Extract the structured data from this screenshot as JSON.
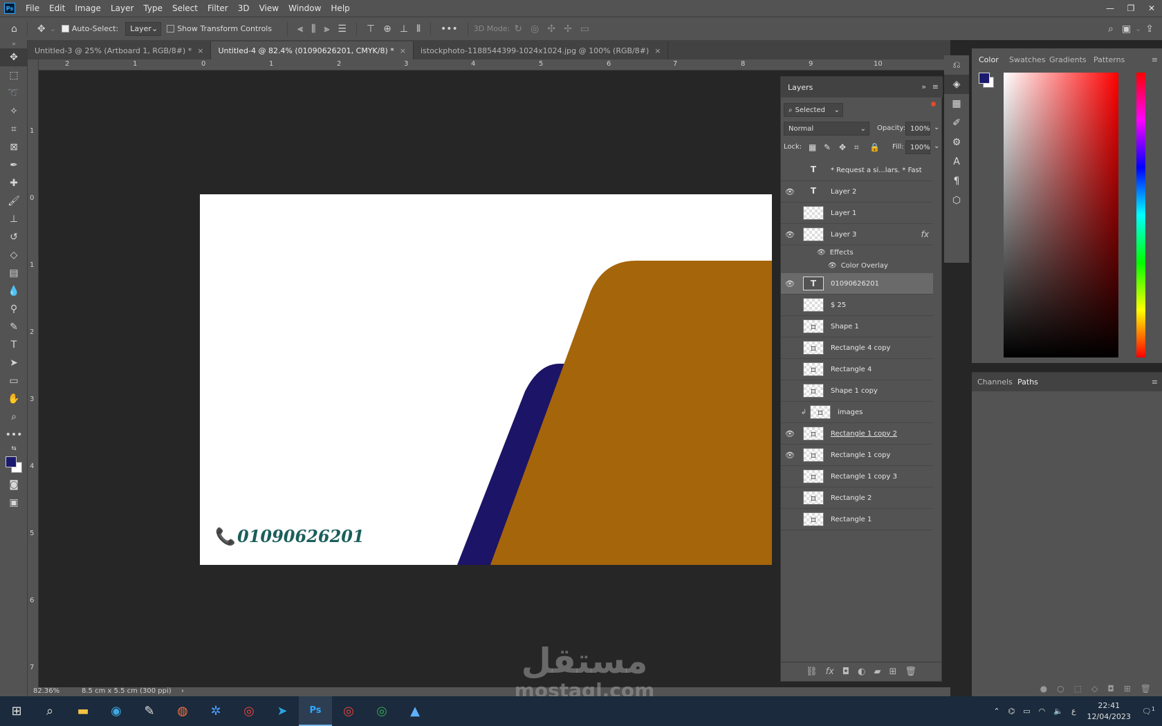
{
  "menubar": {
    "logo": "Ps",
    "items": [
      "File",
      "Edit",
      "Image",
      "Layer",
      "Type",
      "Select",
      "Filter",
      "3D",
      "View",
      "Window",
      "Help"
    ],
    "window_controls": [
      "—",
      "❐",
      "✕"
    ]
  },
  "options_bar": {
    "auto_select_label": "Auto-Select:",
    "auto_select_checked": true,
    "auto_select_target": "Layer",
    "transform_controls_label": "Show Transform Controls",
    "transform_controls_checked": false,
    "more": "•••",
    "mode_3d_label": "3D Mode:"
  },
  "tabs": [
    {
      "label": "Untitled-3 @ 25% (Artboard 1, RGB/8#) *",
      "close": "×",
      "active": false
    },
    {
      "label": "Untitled-4 @ 82.4% (01090626201, CMYK/8) *",
      "close": "×",
      "active": true
    },
    {
      "label": "istockphoto-1188544399-1024x1024.jpg @ 100% (RGB/8#)",
      "close": "×",
      "active": false
    }
  ],
  "ruler": {
    "h_labels": [
      "2",
      "1",
      "0",
      "1",
      "2",
      "3",
      "4",
      "5",
      "6",
      "7",
      "8",
      "9",
      "10"
    ],
    "v_labels": [
      "1",
      "0",
      "1",
      "2",
      "3",
      "4",
      "5",
      "6",
      "7"
    ]
  },
  "canvas": {
    "phone_icon": "📞",
    "phone_number": "01090626201",
    "colors": {
      "background": "#ffffff",
      "navy": "#1c1466",
      "orange": "#a5650a",
      "text": "#1b5e5b"
    }
  },
  "statusbar": {
    "zoom": "82.36%",
    "doc_size": "8.5 cm x 5.5 cm (300 ppi)",
    "arrow": "›"
  },
  "layers_panel": {
    "title": "Layers",
    "filter": "Selected",
    "blend_mode": "Normal",
    "opacity_label": "Opacity:",
    "opacity_value": "100%",
    "lock_label": "Lock:",
    "fill_label": "Fill:",
    "fill_value": "100%",
    "fx_badge": "fx",
    "effects_label": "Effects",
    "color_overlay_label": "Color Overlay",
    "layers": [
      {
        "name": "* Request a si...lars. * Fast",
        "type": "text",
        "visible": false
      },
      {
        "name": "Layer 2",
        "type": "text",
        "visible": true
      },
      {
        "name": "Layer 1",
        "type": "pixel",
        "visible": false
      },
      {
        "name": "Layer 3",
        "type": "pixel",
        "visible": true,
        "fx": true
      },
      {
        "name": "01090626201",
        "type": "text",
        "visible": true,
        "selected": true
      },
      {
        "name": "$ 25",
        "type": "pixel",
        "visible": false
      },
      {
        "name": "Shape 1",
        "type": "shape",
        "visible": false
      },
      {
        "name": "Rectangle 4 copy",
        "type": "shape",
        "visible": false
      },
      {
        "name": "Rectangle 4",
        "type": "shape",
        "visible": false
      },
      {
        "name": "Shape 1 copy",
        "type": "shape",
        "visible": false
      },
      {
        "name": "images",
        "type": "smart",
        "visible": false,
        "clipped": true
      },
      {
        "name": "Rectangle 1 copy 2",
        "type": "shape",
        "visible": true
      },
      {
        "name": "Rectangle 1 copy",
        "type": "shape",
        "visible": true
      },
      {
        "name": "Rectangle 1 copy 3",
        "type": "shape",
        "visible": false
      },
      {
        "name": "Rectangle 2",
        "type": "shape",
        "visible": false
      },
      {
        "name": "Rectangle 1",
        "type": "shape",
        "visible": false
      }
    ]
  },
  "color_panel": {
    "tabs": [
      "Color",
      "Swatches",
      "Gradients",
      "Patterns"
    ],
    "active_tab": "Color",
    "foreground": "#1a1a6e",
    "background": "#ffffff"
  },
  "paths_panel": {
    "tabs": [
      "Channels",
      "Paths"
    ],
    "active_tab": "Paths"
  },
  "taskbar": {
    "time": "22:41",
    "date": "12/04/2023",
    "lang": "ع",
    "notifications": "1"
  },
  "watermark": {
    "arabic": "مستقل",
    "latin": "mostaql.com"
  }
}
